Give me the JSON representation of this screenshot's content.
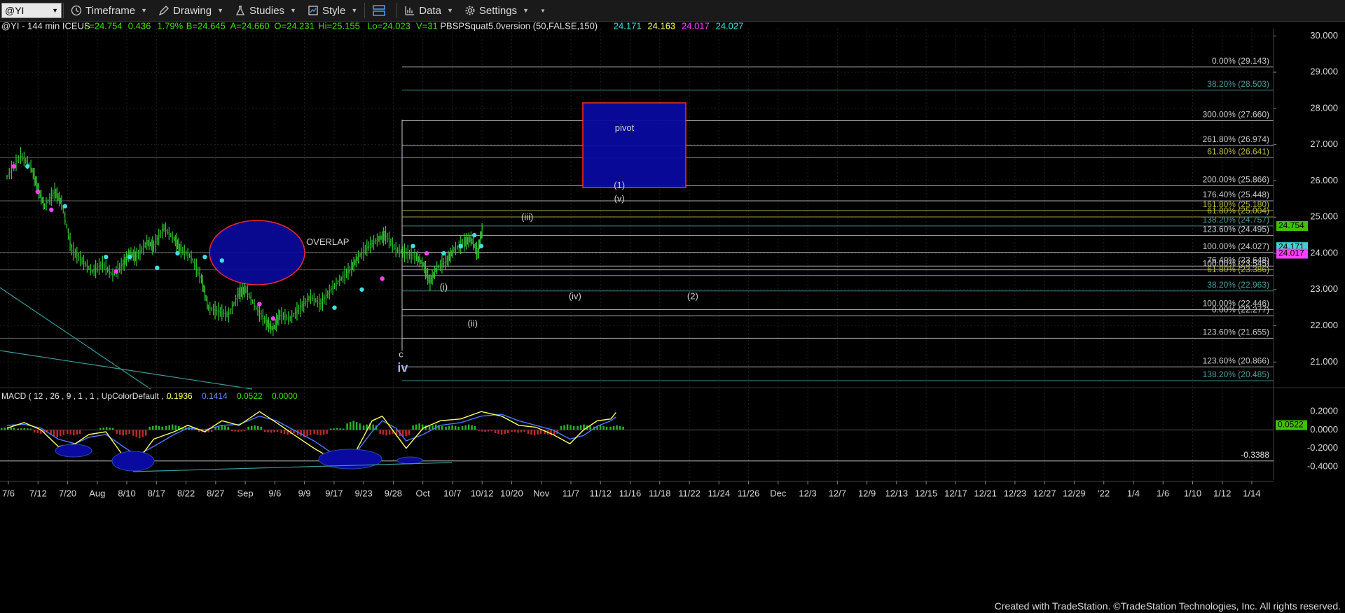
{
  "toolbar": {
    "symbol": "@YI",
    "timeframe": "Timeframe",
    "drawing": "Drawing",
    "studies": "Studies",
    "style": "Style",
    "data": "Data",
    "settings": "Settings"
  },
  "header": {
    "symbol_info": "@YI - 144 min  ICEUS",
    "stats": [
      {
        "text": "L=24.754",
        "color": "#40e000"
      },
      {
        "text": "0.436",
        "color": "#40e000"
      },
      {
        "text": "1.79%",
        "color": "#40e000"
      },
      {
        "text": "B=24.645",
        "color": "#40e000"
      },
      {
        "text": "A=24.660",
        "color": "#40e000"
      },
      {
        "text": "O=24.231",
        "color": "#40e000"
      },
      {
        "text": "Hi=25.155",
        "color": "#40e000"
      },
      {
        "text": "Lo=24.023",
        "color": "#40e000"
      },
      {
        "text": "V=31",
        "color": "#40e000"
      },
      {
        "text": "PBSPSquat5.0version (50,FALSE,150)",
        "color": "#e0e0e0"
      },
      {
        "text": "24.171",
        "color": "#40e0e0"
      },
      {
        "text": "24.163",
        "color": "#ffff60"
      },
      {
        "text": "24.017",
        "color": "#ff40ff"
      },
      {
        "text": "24.027",
        "color": "#40e0e0"
      }
    ]
  },
  "chart_data": {
    "type": "bar",
    "price_axis": {
      "ylim": [
        20.35,
        30.2
      ],
      "ticks": [
        21,
        22,
        23,
        24,
        25,
        26,
        27,
        28,
        29,
        30
      ]
    },
    "price_tick_labels": [
      "21.000",
      "22.000",
      "23.000",
      "24.000",
      "25.000",
      "26.000",
      "27.000",
      "28.000",
      "29.000",
      "30.000"
    ],
    "x_tick_labels": [
      "7/6",
      "7/12",
      "7/20",
      "Aug",
      "8/10",
      "8/17",
      "8/22",
      "8/27",
      "Sep",
      "9/6",
      "9/9",
      "9/17",
      "9/23",
      "9/28",
      "Oct",
      "10/7",
      "10/12",
      "10/20",
      "Nov",
      "11/7",
      "11/12",
      "11/16",
      "11/18",
      "11/22",
      "11/24",
      "11/26",
      "Dec",
      "12/3",
      "12/7",
      "12/9",
      "12/13",
      "12/15",
      "12/17",
      "12/21",
      "12/23",
      "12/27",
      "12/29",
      "'22",
      "1/4",
      "1/6",
      "1/10",
      "1/12",
      "1/14"
    ],
    "price_path": [
      [
        0,
        26.1
      ],
      [
        0.4,
        26.7
      ],
      [
        0.7,
        26.4
      ],
      [
        0.9,
        25.8
      ],
      [
        1.1,
        25.3
      ],
      [
        1.4,
        25.7
      ],
      [
        1.6,
        25.4
      ],
      [
        1.9,
        24.1
      ],
      [
        2.2,
        23.8
      ],
      [
        2.5,
        23.5
      ],
      [
        2.8,
        23.7
      ],
      [
        3.1,
        23.4
      ],
      [
        3.4,
        23.7
      ],
      [
        3.6,
        24.0
      ],
      [
        3.8,
        23.9
      ],
      [
        4.1,
        24.3
      ],
      [
        4.3,
        24.2
      ],
      [
        4.6,
        24.7
      ],
      [
        4.9,
        24.4
      ],
      [
        5.1,
        24.1
      ],
      [
        5.4,
        23.9
      ],
      [
        5.7,
        23.3
      ],
      [
        5.9,
        22.5
      ],
      [
        6.2,
        22.4
      ],
      [
        6.5,
        22.3
      ],
      [
        6.8,
        22.9
      ],
      [
        7.0,
        23.0
      ],
      [
        7.3,
        22.5
      ],
      [
        7.6,
        22.1
      ],
      [
        7.8,
        21.9
      ],
      [
        8.0,
        22.3
      ],
      [
        8.3,
        22.2
      ],
      [
        8.6,
        22.5
      ],
      [
        8.9,
        22.8
      ],
      [
        9.2,
        22.6
      ],
      [
        9.5,
        23.0
      ],
      [
        9.8,
        23.3
      ],
      [
        10.1,
        23.6
      ],
      [
        10.3,
        23.9
      ],
      [
        10.6,
        24.2
      ],
      [
        10.9,
        24.4
      ],
      [
        11.1,
        24.5
      ],
      [
        11.4,
        24.1
      ],
      [
        11.7,
        24.0
      ],
      [
        12.0,
        23.9
      ],
      [
        12.2,
        23.7
      ],
      [
        12.4,
        23.2
      ],
      [
        12.6,
        23.6
      ],
      [
        12.9,
        23.8
      ],
      [
        13.1,
        24.1
      ],
      [
        13.4,
        24.3
      ],
      [
        13.6,
        24.4
      ],
      [
        13.8,
        24.0
      ],
      [
        13.95,
        24.75
      ]
    ],
    "overlay_dots": [
      {
        "x": 0.2,
        "y": 26.4,
        "c": "#ff40ff"
      },
      {
        "x": 0.6,
        "y": 26.4,
        "c": "#40e0e0"
      },
      {
        "x": 0.9,
        "y": 25.7,
        "c": "#ff40ff"
      },
      {
        "x": 1.3,
        "y": 25.2,
        "c": "#ff40ff"
      },
      {
        "x": 1.7,
        "y": 25.3,
        "c": "#40e0e0"
      },
      {
        "x": 2.9,
        "y": 23.9,
        "c": "#40e0e0"
      },
      {
        "x": 3.2,
        "y": 23.5,
        "c": "#ff40ff"
      },
      {
        "x": 3.6,
        "y": 23.9,
        "c": "#40e0e0"
      },
      {
        "x": 4.4,
        "y": 23.6,
        "c": "#40e0e0"
      },
      {
        "x": 5.0,
        "y": 24.0,
        "c": "#40e0e0"
      },
      {
        "x": 5.8,
        "y": 23.9,
        "c": "#40e0e0"
      },
      {
        "x": 6.3,
        "y": 23.8,
        "c": "#40e0e0"
      },
      {
        "x": 7.4,
        "y": 22.6,
        "c": "#ff40ff"
      },
      {
        "x": 7.8,
        "y": 22.2,
        "c": "#ff40ff"
      },
      {
        "x": 9.6,
        "y": 22.5,
        "c": "#40e0e0"
      },
      {
        "x": 10.4,
        "y": 23.0,
        "c": "#40e0e0"
      },
      {
        "x": 11.0,
        "y": 23.3,
        "c": "#ff40ff"
      },
      {
        "x": 11.9,
        "y": 24.2,
        "c": "#40e0e0"
      },
      {
        "x": 12.3,
        "y": 24.0,
        "c": "#ff40ff"
      },
      {
        "x": 12.8,
        "y": 24.0,
        "c": "#40e0e0"
      },
      {
        "x": 13.3,
        "y": 24.2,
        "c": "#40e0e0"
      },
      {
        "x": 13.7,
        "y": 24.5,
        "c": "#40e0e0"
      },
      {
        "x": 13.9,
        "y": 24.2,
        "c": "#40e0e0"
      }
    ],
    "fib_lines": [
      {
        "label": "0.00% (29.143)",
        "y": 29.143,
        "color": "#c8c8c8"
      },
      {
        "label": "38.20% (28.503)",
        "y": 28.503,
        "color": "#4a9a9a"
      },
      {
        "label": "300.00% (27.660)",
        "y": 27.66,
        "color": "#c8c8c8"
      },
      {
        "label": "261.80% (26.974)",
        "y": 26.974,
        "color": "#c8c8c8"
      },
      {
        "label": "61.80% (26.641)",
        "y": 26.641,
        "color": "#b8b840"
      },
      {
        "label": "200.00% (25.866)",
        "y": 25.866,
        "color": "#c8c8c8"
      },
      {
        "label": "176.40% (25.448)",
        "y": 25.448,
        "color": "#c8c8c8"
      },
      {
        "label": "161.80% (25.180)",
        "y": 25.18,
        "color": "#b8b840"
      },
      {
        "label": "61.80% (25.004)",
        "y": 25.004,
        "color": "#b8b840"
      },
      {
        "label": "138.20% (24.757)",
        "y": 24.757,
        "color": "#4a9a9a"
      },
      {
        "label": "123.60% (24.495)",
        "y": 24.495,
        "color": "#c8c8c8"
      },
      {
        "label": "100.00% (24.027)",
        "y": 24.027,
        "color": "#c8c8c8"
      },
      {
        "label": "76.40% (23.648)",
        "y": 23.648,
        "color": "#c8c8c8"
      },
      {
        "label": "100.00% (23.545)",
        "y": 23.545,
        "color": "#c8c8c8"
      },
      {
        "label": "61.80% (23.386)",
        "y": 23.386,
        "color": "#b8b840"
      },
      {
        "label": "38.20% (22.963)",
        "y": 22.963,
        "color": "#4a9a9a"
      },
      {
        "label": "100.00% (22.446)",
        "y": 22.446,
        "color": "#c8c8c8"
      },
      {
        "label": "0.00% (22.277)",
        "y": 22.277,
        "color": "#c8c8c8"
      },
      {
        "label": "123.60% (21.655)",
        "y": 21.655,
        "color": "#c8c8c8"
      },
      {
        "label": "123.60% (20.866)",
        "y": 20.866,
        "color": "#c8c8c8"
      },
      {
        "label": "138.20% (20.485)",
        "y": 20.485,
        "color": "#4a9a9a"
      }
    ],
    "price_badges": [
      {
        "text": "24.754",
        "y": 24.754,
        "bg": "#40c000",
        "fg": "#000"
      },
      {
        "text": "24.171",
        "y": 24.171,
        "bg": "#40d0d0",
        "fg": "#000"
      },
      {
        "text": "24.017",
        "y": 23.99,
        "bg": "#ff40ff",
        "fg": "#000"
      }
    ],
    "annotations": [
      {
        "text": "pivot",
        "x": 18.1,
        "y": 27.45,
        "size": 13
      },
      {
        "text": "OVERLAP",
        "x": 9.4,
        "y": 24.3,
        "size": 13
      },
      {
        "text": "(1)",
        "x": 17.95,
        "y": 25.86,
        "size": 13
      },
      {
        "text": "(v)",
        "x": 17.95,
        "y": 25.5,
        "size": 13
      },
      {
        "text": "(iii)",
        "x": 15.25,
        "y": 24.98,
        "size": 13
      },
      {
        "text": "(i)",
        "x": 12.8,
        "y": 23.05,
        "size": 13
      },
      {
        "text": "(ii)",
        "x": 13.65,
        "y": 22.05,
        "size": 13
      },
      {
        "text": "(iv)",
        "x": 16.65,
        "y": 22.8,
        "size": 13
      },
      {
        "text": "(2)",
        "x": 20.1,
        "y": 22.8,
        "size": 13
      },
      {
        "text": "c",
        "x": 11.55,
        "y": 21.2,
        "size": 13
      },
      {
        "text": "iv",
        "x": 11.6,
        "y": 20.82,
        "size": 18
      }
    ],
    "macd": {
      "label": "MACD ( 12 , 26 , 9 , 1 , 1 , UpColorDefault , ...",
      "values": [
        {
          "text": "0.1936",
          "color": "#ffff60"
        },
        {
          "text": "0.1414",
          "color": "#6090ff"
        },
        {
          "text": "0.0522",
          "color": "#40e000"
        },
        {
          "text": "0.0000",
          "color": "#40e000"
        }
      ],
      "ylim": [
        -0.47,
        0.27
      ],
      "ticks": [
        -0.4,
        -0.2,
        0,
        0.2
      ],
      "tick_labels": [
        "-0.4000",
        "-0.2000",
        "0.0000",
        "0.2000"
      ],
      "level": {
        "label": "-0.3388",
        "y": -0.3388
      },
      "badge": {
        "text": "0.0522",
        "y": 0.0522
      },
      "macd_line": [
        [
          0,
          0.02
        ],
        [
          0.5,
          0.08
        ],
        [
          1.0,
          0.0
        ],
        [
          1.5,
          -0.18
        ],
        [
          2.0,
          -0.15
        ],
        [
          2.4,
          -0.05
        ],
        [
          2.9,
          -0.02
        ],
        [
          3.4,
          -0.28
        ],
        [
          3.8,
          -0.35
        ],
        [
          4.3,
          -0.1
        ],
        [
          4.9,
          -0.02
        ],
        [
          5.3,
          0.05
        ],
        [
          5.8,
          -0.02
        ],
        [
          6.3,
          0.1
        ],
        [
          6.8,
          0.05
        ],
        [
          7.4,
          0.2
        ],
        [
          7.9,
          0.08
        ],
        [
          8.4,
          -0.05
        ],
        [
          9.0,
          -0.2
        ],
        [
          9.6,
          -0.33
        ],
        [
          10.2,
          -0.25
        ],
        [
          10.7,
          0.1
        ],
        [
          11.0,
          0.15
        ],
        [
          11.4,
          -0.05
        ],
        [
          11.7,
          -0.2
        ],
        [
          12.2,
          0.02
        ],
        [
          12.7,
          0.1
        ],
        [
          13.3,
          0.12
        ],
        [
          13.9,
          0.2
        ],
        [
          14.5,
          0.15
        ],
        [
          15.0,
          0.05
        ],
        [
          15.5,
          0.03
        ],
        [
          16.0,
          -0.05
        ],
        [
          16.5,
          -0.15
        ],
        [
          16.9,
          0.0
        ],
        [
          17.3,
          0.1
        ],
        [
          17.7,
          0.12
        ],
        [
          17.85,
          0.19
        ]
      ],
      "signal_line": [
        [
          0,
          0.05
        ],
        [
          0.5,
          0.06
        ],
        [
          1.0,
          0.02
        ],
        [
          1.5,
          -0.1
        ],
        [
          2.0,
          -0.15
        ],
        [
          2.4,
          -0.08
        ],
        [
          2.9,
          -0.05
        ],
        [
          3.4,
          -0.18
        ],
        [
          3.8,
          -0.28
        ],
        [
          4.3,
          -0.18
        ],
        [
          4.9,
          -0.05
        ],
        [
          5.3,
          0.02
        ],
        [
          5.8,
          0.0
        ],
        [
          6.3,
          0.05
        ],
        [
          6.8,
          0.06
        ],
        [
          7.4,
          0.15
        ],
        [
          7.9,
          0.1
        ],
        [
          8.4,
          0.0
        ],
        [
          9.0,
          -0.12
        ],
        [
          9.6,
          -0.27
        ],
        [
          10.2,
          -0.26
        ],
        [
          10.7,
          -0.02
        ],
        [
          11.0,
          0.1
        ],
        [
          11.4,
          0.02
        ],
        [
          11.7,
          -0.12
        ],
        [
          12.2,
          -0.05
        ],
        [
          12.7,
          0.05
        ],
        [
          13.3,
          0.08
        ],
        [
          13.9,
          0.15
        ],
        [
          14.5,
          0.17
        ],
        [
          15.0,
          0.1
        ],
        [
          15.5,
          0.05
        ],
        [
          16.0,
          0.0
        ],
        [
          16.5,
          -0.1
        ],
        [
          16.9,
          -0.06
        ],
        [
          17.3,
          0.04
        ],
        [
          17.7,
          0.1
        ],
        [
          17.85,
          0.14
        ]
      ],
      "histogram": [
        0.03,
        0.02,
        -0.04,
        -0.08,
        -0.06,
        0.0,
        0.03,
        -0.06,
        -0.09,
        0.05,
        0.06,
        0.03,
        -0.03,
        0.05,
        -0.02,
        0.05,
        -0.03,
        -0.05,
        -0.08,
        -0.06,
        0.02,
        0.1,
        0.07,
        -0.06,
        -0.08,
        0.07,
        0.06,
        0.05,
        0.06,
        -0.02,
        -0.05,
        -0.03,
        -0.06,
        -0.06,
        0.06,
        0.06,
        0.05,
        0.05
      ]
    }
  },
  "footer": "Created with TradeStation. ©TradeStation Technologies, Inc. All rights reserved."
}
